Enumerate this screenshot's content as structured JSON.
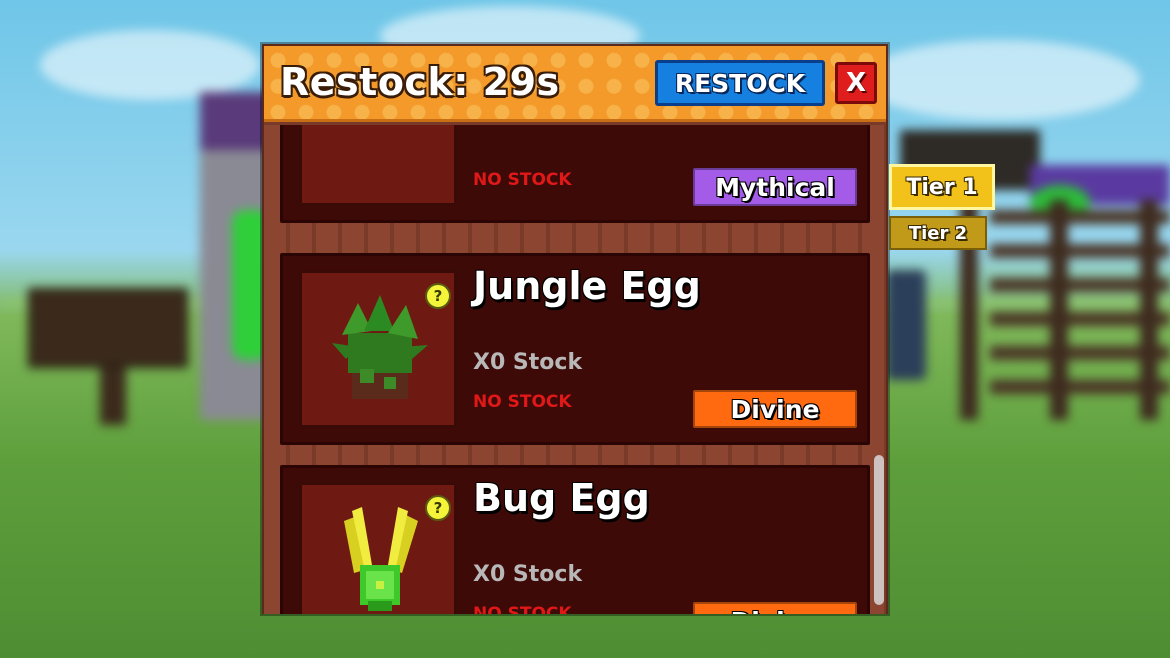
{
  "header": {
    "restock_timer": "Restock: 29s",
    "restock_button_label": "RESTOCK",
    "close_button_label": "X"
  },
  "shop_items": [
    {
      "name": "",
      "stock_text": "",
      "no_stock_text": "NO STOCK",
      "rarity": "Mythical",
      "rarity_color": "#a35be8"
    },
    {
      "name": "Jungle Egg",
      "stock_text": "X0 Stock",
      "no_stock_text": "NO STOCK",
      "rarity": "Divine",
      "rarity_color": "#ff6a10",
      "info_icon": "?"
    },
    {
      "name": "Bug Egg",
      "stock_text": "X0 Stock",
      "no_stock_text": "NO STOCK",
      "rarity": "Divine",
      "rarity_color": "#ff6a10",
      "info_icon": "?"
    }
  ],
  "tiers": [
    {
      "label": "Tier 1",
      "selected": true
    },
    {
      "label": "Tier 2",
      "selected": false
    }
  ],
  "colors": {
    "header_orange": "#f39a2a",
    "restock_blue": "#1580e0",
    "close_red": "#e01d1d",
    "no_stock_red": "#e01818",
    "tier_gold": "#f2c21a"
  }
}
